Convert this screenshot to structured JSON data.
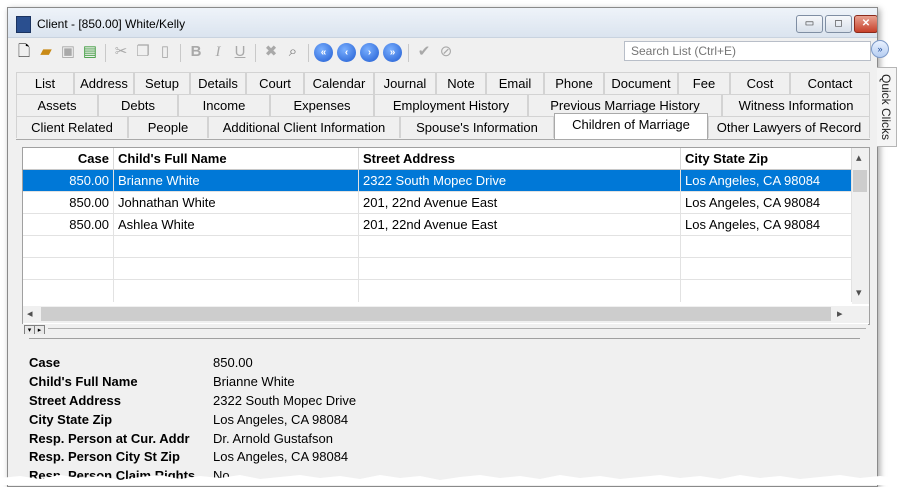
{
  "window": {
    "title": "Client - [850.00] White/Kelly",
    "buttons": {
      "minimize": "▭",
      "maximize": "◻",
      "close": "✕"
    }
  },
  "toolbar": {
    "search_placeholder": "Search List (Ctrl+E)"
  },
  "tabs": {
    "row1": [
      "List",
      "Address",
      "Setup",
      "Details",
      "Court",
      "Calendar",
      "Journal",
      "Note",
      "Email",
      "Phone",
      "Document",
      "Fee",
      "Cost",
      "Contact"
    ],
    "row2": [
      "Assets",
      "Debts",
      "Income",
      "Expenses",
      "Employment History",
      "Previous Marriage History",
      "Witness Information"
    ],
    "row3": [
      "Client Related",
      "People",
      "Additional Client Information",
      "Spouse's Information",
      "Children of Marriage",
      "Other Lawyers of Record"
    ],
    "active": "Children of Marriage"
  },
  "grid": {
    "columns": [
      "Case",
      "Child's Full Name",
      "Street Address",
      "City State Zip"
    ],
    "rows": [
      [
        "850.00",
        "Brianne White",
        "2322 South Mopec Drive",
        "Los Angeles, CA 98084"
      ],
      [
        "850.00",
        "Johnathan White",
        "201, 22nd Avenue East",
        "Los Angeles, CA 98084"
      ],
      [
        "850.00",
        "Ashlea White",
        "201, 22nd Avenue East",
        "Los Angeles, CA 98084"
      ]
    ],
    "selected_row": 0
  },
  "detail": {
    "fields": [
      {
        "label": "Case",
        "value": "850.00"
      },
      {
        "label": "Child's Full Name",
        "value": "Brianne White"
      },
      {
        "label": "Street Address",
        "value": "2322 South Mopec Drive"
      },
      {
        "label": "City State Zip",
        "value": "Los Angeles, CA 98084"
      },
      {
        "label": "Resp. Person at Cur. Addr",
        "value": "Dr. Arnold Gustafson"
      },
      {
        "label": "Resp. Person City St Zip",
        "value": "Los Angeles, CA 98084"
      },
      {
        "label": "Resp. Person Claim Rights",
        "value": "No"
      }
    ]
  },
  "side_panel": {
    "label": "Quick Clicks"
  },
  "colors": {
    "selection": "#0078d7",
    "accent_button": "#1f5bd1",
    "close_button": "#c7412b"
  },
  "icons": [
    "new-document-icon",
    "open-folder-icon",
    "save-icon",
    "save-close-icon",
    "cut-icon",
    "copy-icon",
    "paste-icon",
    "bold-icon",
    "italic-icon",
    "underline-icon",
    "delete-icon",
    "find-icon",
    "first-record-icon",
    "previous-record-icon",
    "next-record-icon",
    "last-record-icon",
    "accept-icon",
    "cancel-icon"
  ]
}
